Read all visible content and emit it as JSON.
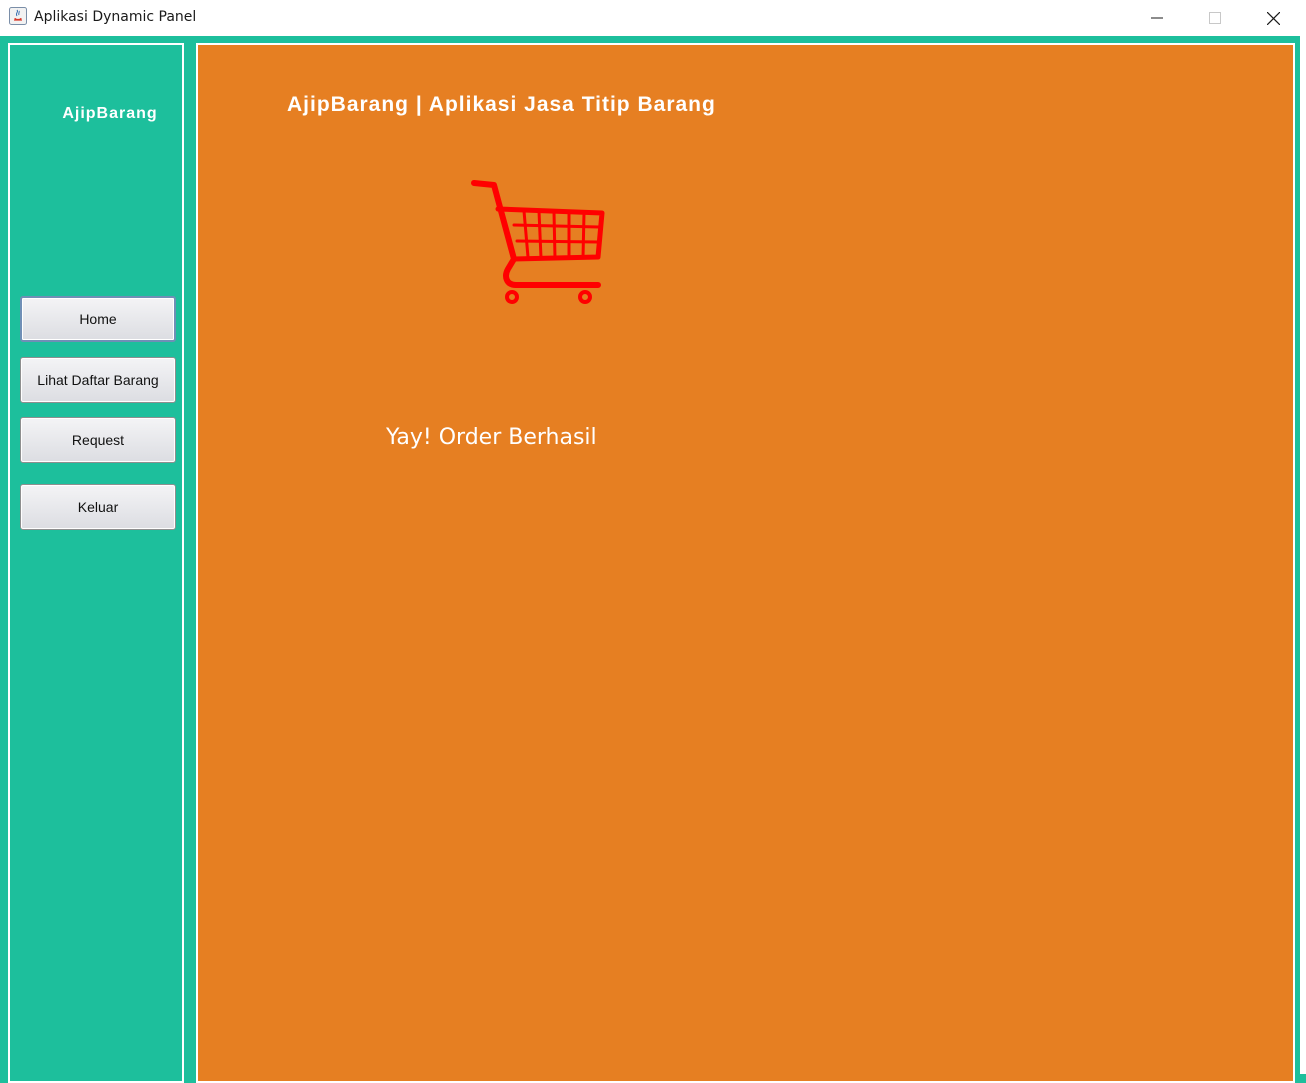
{
  "window": {
    "title": "Aplikasi Dynamic Panel",
    "icon": "java-icon",
    "controls": [
      "minimize-icon",
      "maximize-icon",
      "close-icon"
    ]
  },
  "sidebar": {
    "brand": "AjipBarang",
    "items": [
      {
        "label": "Home"
      },
      {
        "label": "Lihat Daftar Barang"
      },
      {
        "label": "Request"
      },
      {
        "label": "Keluar"
      }
    ]
  },
  "main": {
    "title": "AjipBarang | Aplikasi Jasa Titip Barang",
    "image": "shopping-cart-icon",
    "message": "Yay! Order Berhasil"
  },
  "colors": {
    "sidebar_bg": "#1dbf9c",
    "content_bg": "#e67f22",
    "cart": "#ff0000",
    "text": "#ffffff"
  }
}
